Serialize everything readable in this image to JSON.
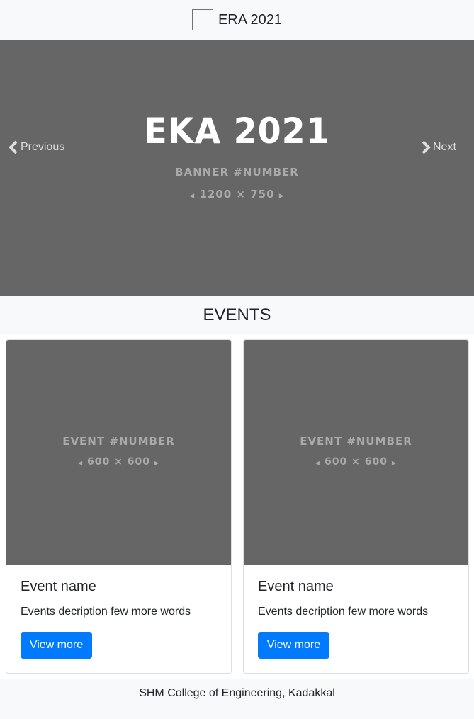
{
  "navbar": {
    "brand_text": "ERA 2021",
    "logo_icon": "logo-placeholder"
  },
  "carousel": {
    "title": "EKA 2021",
    "subtitle": "BANNER #NUMBER",
    "size_label": "1200 × 750",
    "prev_label": "Previous",
    "next_label": "Next",
    "background_color": "#666666"
  },
  "events": {
    "heading": "EVENTS",
    "cards": [
      {
        "image_label": "EVENT #NUMBER",
        "image_size": "600 × 600",
        "title": "Event name",
        "description": "Events decription few more words",
        "button_label": "View more"
      },
      {
        "image_label": "EVENT #NUMBER",
        "image_size": "600 × 600",
        "title": "Event name",
        "description": "Events decription few more words",
        "button_label": "View more"
      }
    ]
  },
  "footer": {
    "text": "SHM College of Engineering, Kadakkal"
  },
  "colors": {
    "primary": "#007bff",
    "light_bg": "#f8f9fa",
    "placeholder_gray": "#666666"
  }
}
